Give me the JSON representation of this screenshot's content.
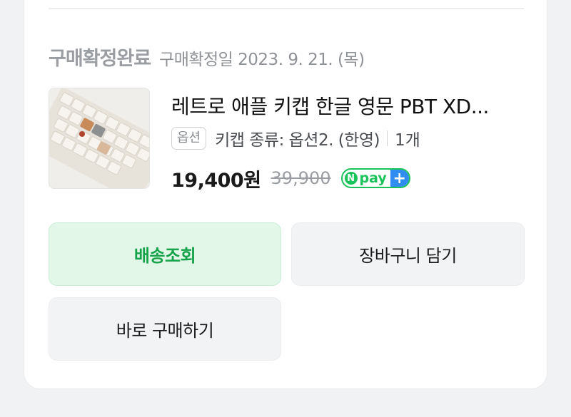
{
  "order": {
    "status_title": "구매확정완료",
    "status_date": "구매확정일 2023. 9. 21. (목)"
  },
  "product": {
    "name": "레트로 애플 키캡 한글 영문 PBT XD...",
    "option_badge": "옵션",
    "option_text": "키캡 종류: 옵션2. (한영)",
    "quantity": "1개",
    "price": "19,400원",
    "original_price": "39,900",
    "npay": {
      "n": "N",
      "label": "pay",
      "plus": "+"
    }
  },
  "actions": {
    "track_label": "배송조회",
    "cart_label": "장바구니 담기",
    "buy_again_label": "바로 구매하기"
  },
  "colors": {
    "accent_green": "#16a34a",
    "npay_green": "#19c35a",
    "npay_blue": "#2f8cf0"
  }
}
